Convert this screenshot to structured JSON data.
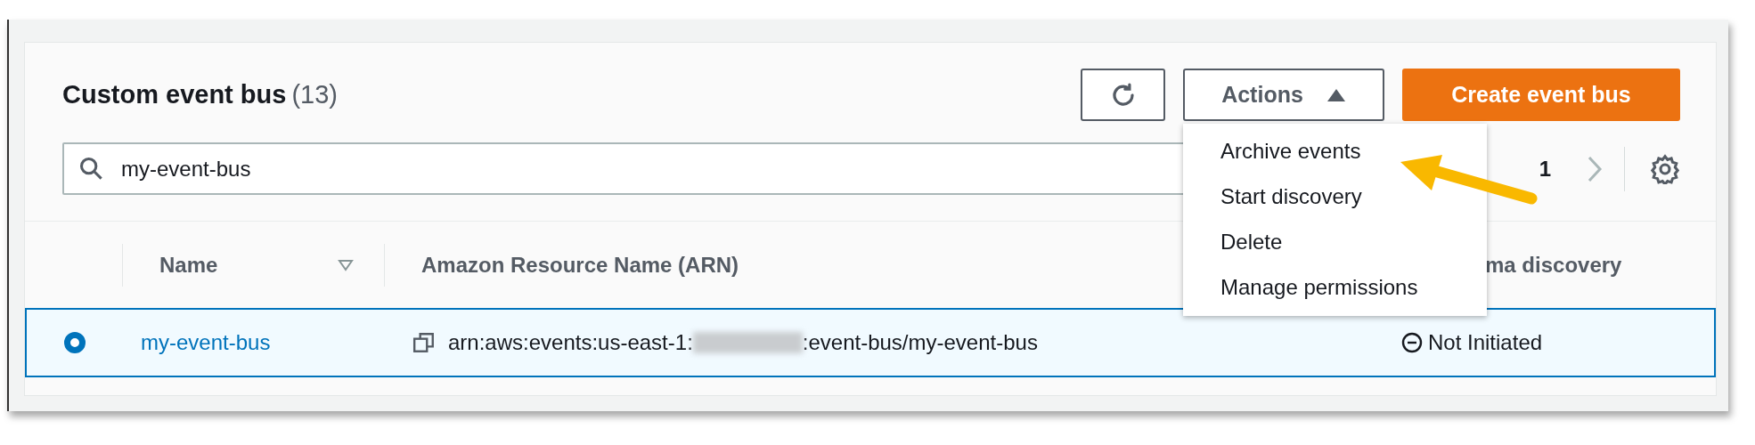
{
  "panel": {
    "title": "Custom event bus",
    "count": "(13)"
  },
  "toolbar": {
    "actions_label": "Actions",
    "actions_expanded": true,
    "create_label": "Create event bus"
  },
  "actions_menu": [
    {
      "label": "Archive events"
    },
    {
      "label": "Start discovery"
    },
    {
      "label": "Delete"
    },
    {
      "label": "Manage permissions"
    }
  ],
  "search": {
    "value": "my-event-bus"
  },
  "pagination": {
    "page": "1"
  },
  "table": {
    "columns": [
      {
        "label": "Name",
        "sortable": true
      },
      {
        "label": "Amazon Resource Name (ARN)",
        "sortable": false
      },
      {
        "label": "ma discovery"
      }
    ],
    "rows": [
      {
        "selected": true,
        "name": "my-event-bus",
        "arn_prefix": "arn:aws:events:us-east-1:",
        "arn_suffix": ":event-bus/my-event-bus",
        "status": "Not Initiated"
      }
    ]
  },
  "annotation": {
    "kind": "arrow"
  }
}
